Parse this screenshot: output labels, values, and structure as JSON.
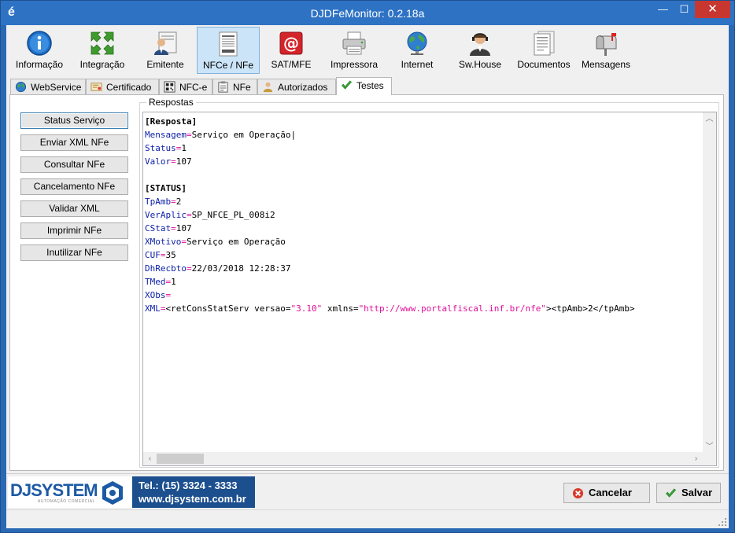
{
  "window": {
    "title": "DJDFeMonitor: 0.2.18a",
    "app_icon": "é",
    "minimize": "—",
    "maximize": "☐",
    "close": "✕"
  },
  "toolbar": {
    "items": [
      {
        "label": "Informação",
        "icon": "info-icon"
      },
      {
        "label": "Integração",
        "icon": "arrows-icon"
      },
      {
        "label": "Emitente",
        "icon": "person-icon"
      },
      {
        "label": "NFCe / NFe",
        "icon": "document-icon"
      },
      {
        "label": "SAT/MFE",
        "icon": "at-icon"
      },
      {
        "label": "Impressora",
        "icon": "printer-icon"
      },
      {
        "label": "Internet",
        "icon": "globe-icon"
      },
      {
        "label": "Sw.House",
        "icon": "headset-icon"
      },
      {
        "label": "Documentos",
        "icon": "documents-icon"
      },
      {
        "label": "Mensagens",
        "icon": "mailbox-icon"
      }
    ],
    "active": "NFCe / NFe"
  },
  "tabs": {
    "items": [
      {
        "label": "WebService"
      },
      {
        "label": "Certificado"
      },
      {
        "label": "NFC-e"
      },
      {
        "label": "NFe"
      },
      {
        "label": "Autorizados"
      },
      {
        "label": "Testes"
      }
    ],
    "active": "Testes"
  },
  "actions": {
    "status_servico": "Status Serviço",
    "enviar_xml": "Enviar XML NFe",
    "consultar": "Consultar NFe",
    "cancelamento": "Cancelamento NFe",
    "validar_xml": "Validar XML",
    "imprimir": "Imprimir NFe",
    "inutilizar": "Inutilizar NFe"
  },
  "respostas": {
    "title": "Respostas",
    "lines": [
      {
        "type": "header",
        "text": "[Resposta]"
      },
      {
        "type": "kv",
        "key": "Mensagem",
        "value": "Serviço em Operação|"
      },
      {
        "type": "kv",
        "key": "Status",
        "value": "1"
      },
      {
        "type": "kv",
        "key": "Valor",
        "value": "107"
      },
      {
        "type": "blank",
        "text": ""
      },
      {
        "type": "header",
        "text": "[STATUS]"
      },
      {
        "type": "kv",
        "key": "TpAmb",
        "value": "2"
      },
      {
        "type": "kv",
        "key": "VerAplic",
        "value": "SP_NFCE_PL_008i2"
      },
      {
        "type": "kv",
        "key": "CStat",
        "value": "107"
      },
      {
        "type": "kv",
        "key": "XMotivo",
        "value": "Serviço em Operação"
      },
      {
        "type": "kv",
        "key": "CUF",
        "value": "35"
      },
      {
        "type": "kv",
        "key": "DhRecbto",
        "value": "22/03/2018 12:28:37"
      },
      {
        "type": "kv",
        "key": "TMed",
        "value": "1"
      },
      {
        "type": "kv",
        "key": "XObs",
        "value": ""
      },
      {
        "type": "xml",
        "key": "XML",
        "value": "<retConsStatServ versao=\"3.10\" xmlns=\"http://www.portalfiscal.inf.br/nfe\"><tpAmb>2</tpAmb>"
      }
    ]
  },
  "footer": {
    "brand": "DJSYSTEM",
    "brand_sub": "AUTOMAÇÃO COMERCIAL",
    "phone": "Tel.: (15) 3324 - 3333",
    "site": "www.djsystem.com.br",
    "cancel": "Cancelar",
    "save": "Salvar"
  }
}
